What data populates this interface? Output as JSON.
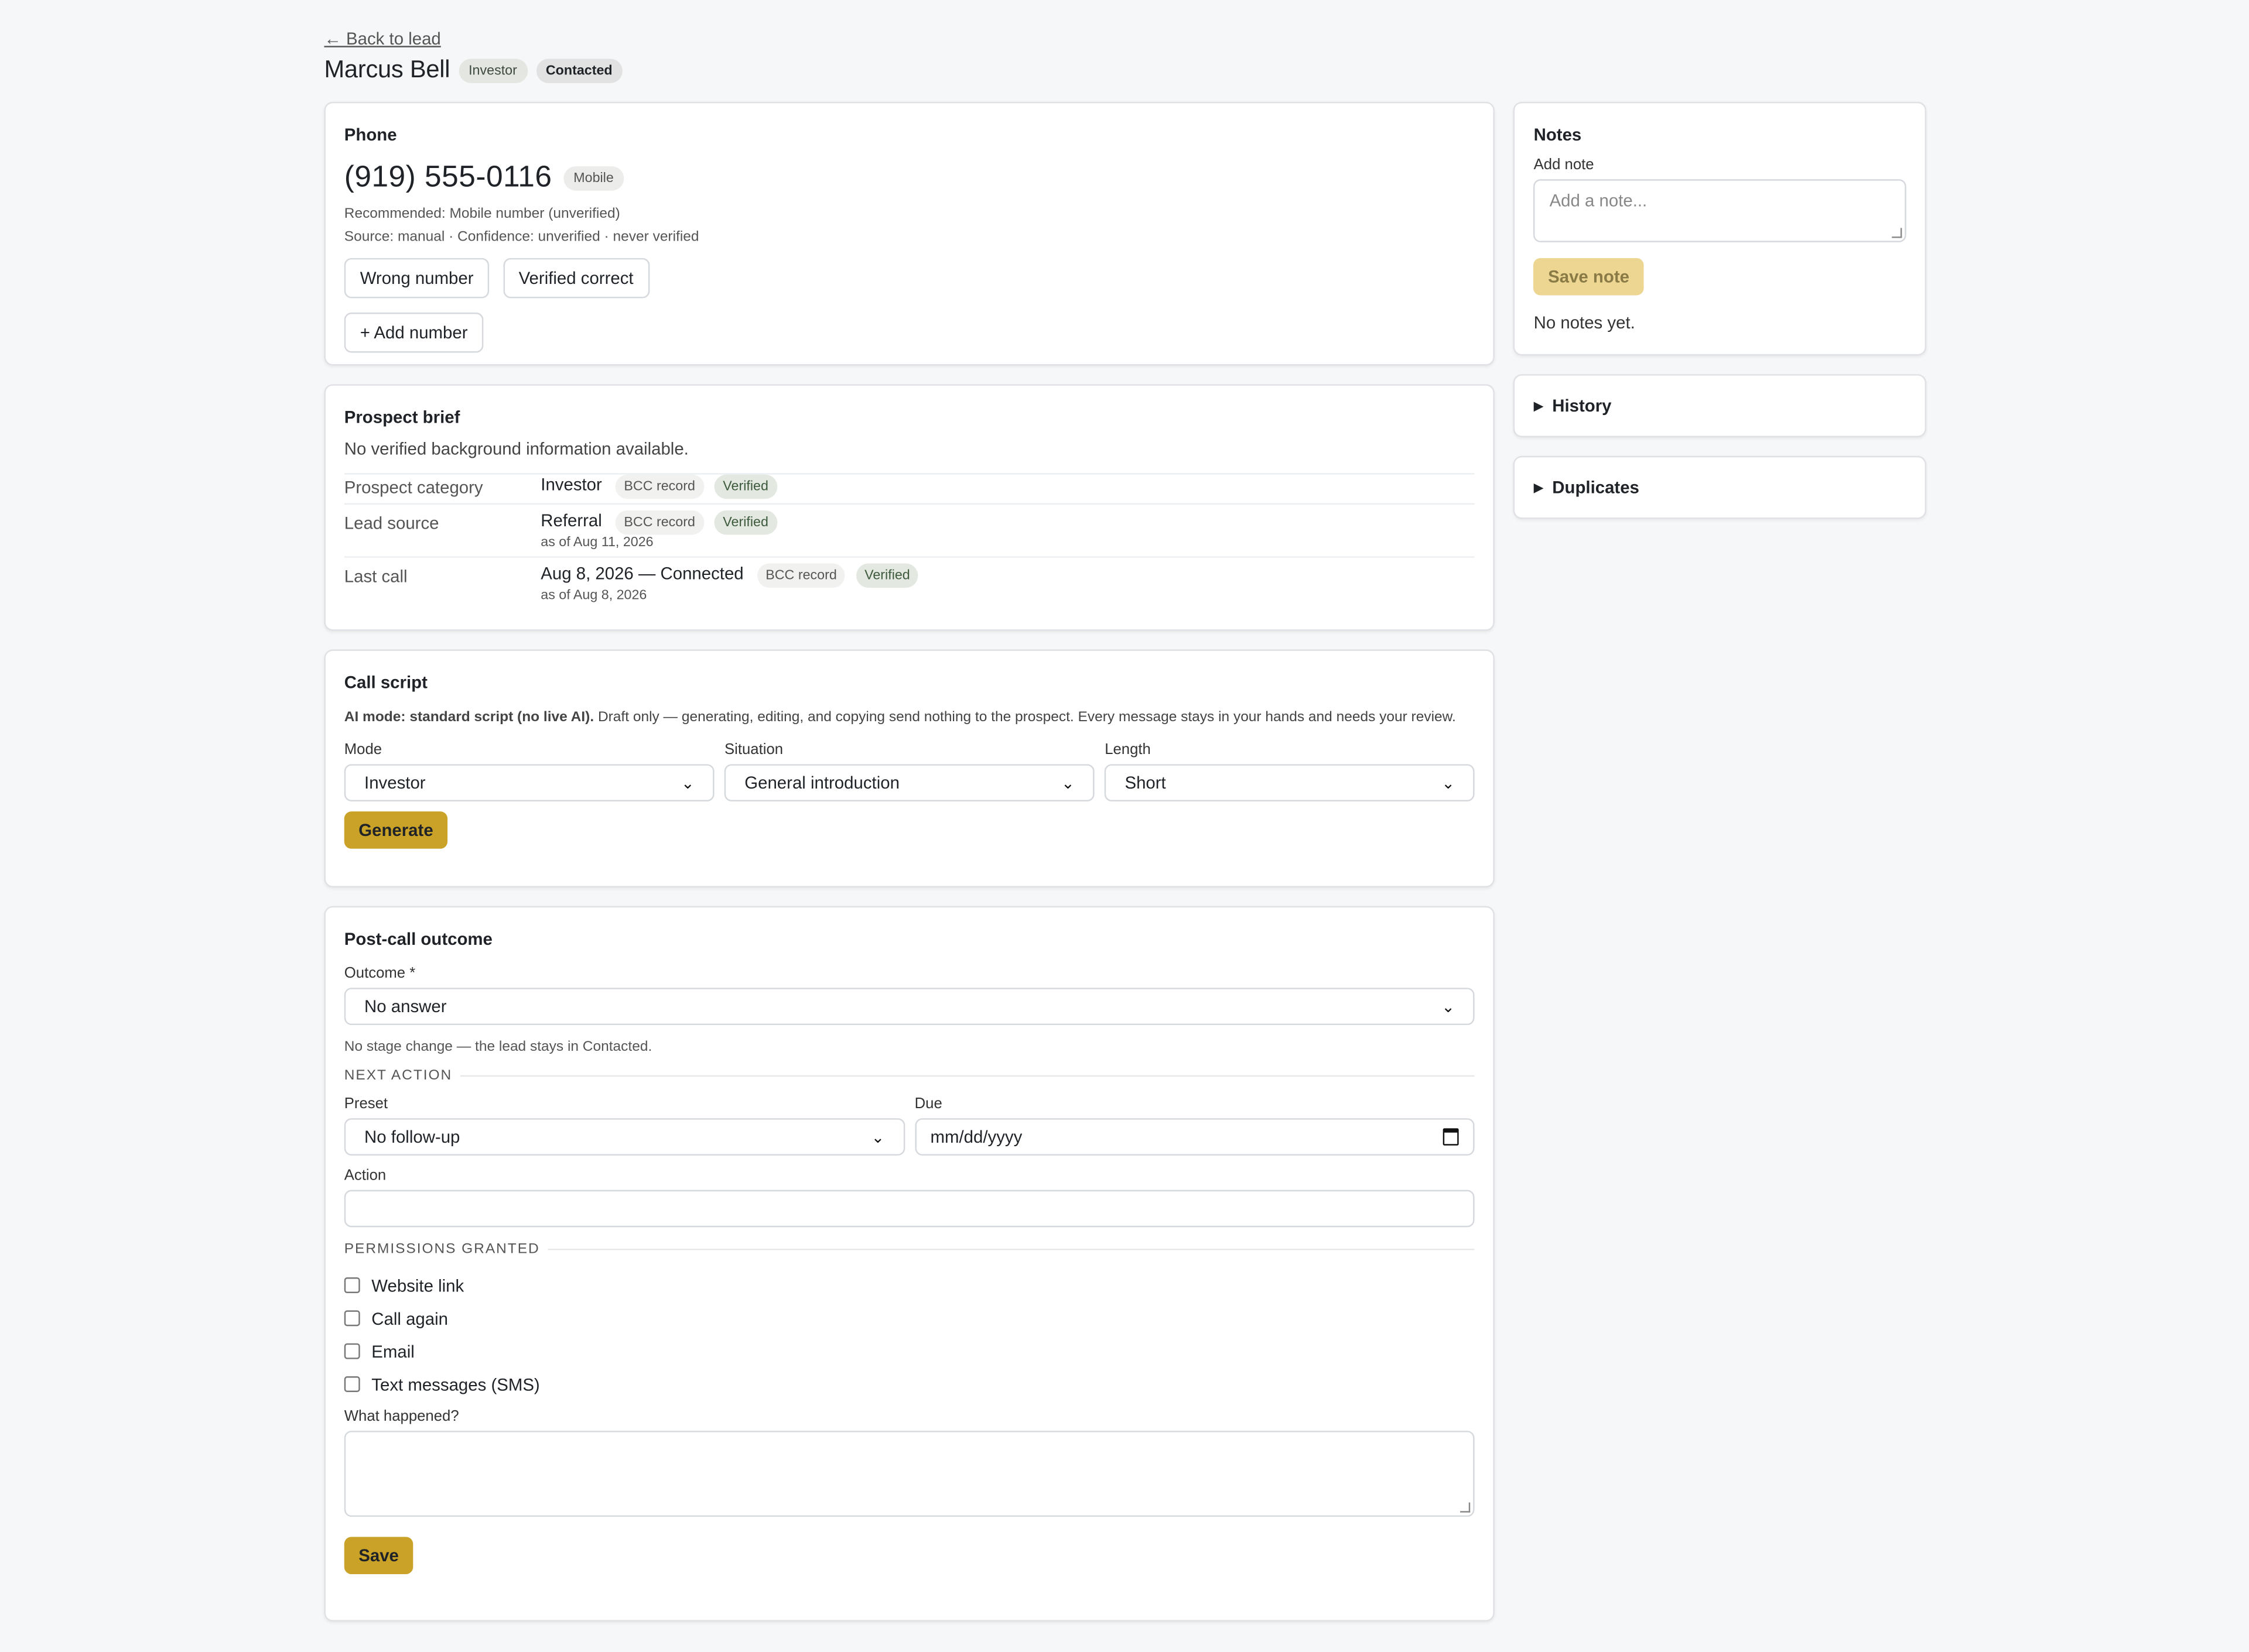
{
  "nav": {
    "back_label": "← Back to lead"
  },
  "header": {
    "name": "Marcus Bell",
    "badges": [
      "Investor",
      "Contacted"
    ]
  },
  "phone": {
    "title": "Phone",
    "number": "(919) 555-0116",
    "type": "Mobile",
    "recommended": "Recommended: Mobile number (unverified)",
    "source": "Source: manual · Confidence: unverified · never verified",
    "wrong_label": "Wrong number",
    "verified_label": "Verified correct",
    "add_label": "+ Add number"
  },
  "brief": {
    "title": "Prospect brief",
    "note": "No verified background information available.",
    "rows": [
      {
        "label": "Prospect category",
        "value": "Investor",
        "src": "BCC record",
        "status": "Verified",
        "asof": ""
      },
      {
        "label": "Lead source",
        "value": "Referral",
        "src": "BCC record",
        "status": "Verified",
        "asof": "as of Aug 11, 2026"
      },
      {
        "label": "Last call",
        "value": "Aug 8, 2026 — Connected",
        "src": "BCC record",
        "status": "Verified",
        "asof": "as of Aug 8, 2026"
      }
    ]
  },
  "script": {
    "title": "Call script",
    "ai_mode": "AI mode: standard script (no live AI).",
    "disclaimer": " Draft only — generating, editing, and copying send nothing to the prospect. Every message stays in your hands and needs your review.",
    "mode_label": "Mode",
    "mode_value": "Investor",
    "situation_label": "Situation",
    "situation_value": "General introduction",
    "length_label": "Length",
    "length_value": "Short",
    "generate_label": "Generate"
  },
  "outcome": {
    "title": "Post-call outcome",
    "outcome_label": "Outcome *",
    "outcome_value": "No answer",
    "stage_note": "No stage change — the lead stays in Contacted.",
    "next_action_hd": "NEXT ACTION",
    "preset_label": "Preset",
    "preset_value": "No follow-up",
    "due_label": "Due",
    "due_placeholder": "mm/dd/yyyy",
    "action_label": "Action",
    "permissions_hd": "PERMISSIONS GRANTED",
    "permissions": [
      "Website link",
      "Call again",
      "Email",
      "Text messages (SMS)"
    ],
    "what_label": "What happened?",
    "save_label": "Save"
  },
  "notes": {
    "title": "Notes",
    "add_label": "Add note",
    "placeholder": "Add a note...",
    "save_label": "Save note",
    "empty": "No notes yet."
  },
  "history": {
    "label": "History"
  },
  "duplicates": {
    "label": "Duplicates"
  },
  "colors": {
    "accent": "#c9a227",
    "accent_disabled": "#ecd692",
    "bg": "#f6f7f8"
  }
}
